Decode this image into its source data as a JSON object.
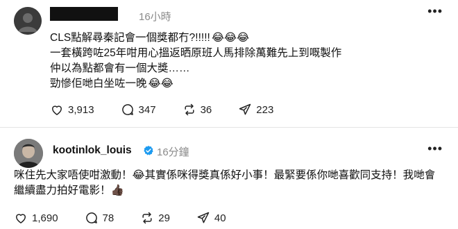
{
  "post1": {
    "time": "16小時",
    "lines": [
      "CLS點解尋秦記會一個獎都冇?!!!!!",
      "一套橫跨咗25年咁用心搵返晒原班人馬排除萬難先上到嘅製作",
      "仲以為點都會有一個大獎……",
      "勁慘佢哋白坐咗一晚"
    ],
    "emoji_line1": "😂😂😂",
    "emoji_line4": "😂😂",
    "likes": "3,913",
    "comments": "347",
    "reposts": "36",
    "shares": "223"
  },
  "post2": {
    "username": "kootinlok_louis",
    "time": "16分鐘",
    "lines": [
      "咪住先大家唔使咁激動！😂其實係咪得獎真係好小事！最緊要係你哋喜歡同支持！我哋會",
      "繼續盡力拍好電影！👍🏿"
    ],
    "likes": "1,690",
    "comments": "78",
    "reposts": "29",
    "shares": "40"
  },
  "icons": {
    "more": "more-icon",
    "like": "heart-icon",
    "comment": "comment-icon",
    "repost": "repost-icon",
    "share": "share-icon",
    "verified": "verified-badge-icon"
  },
  "colors": {
    "verified": "#1d9bf0",
    "muted": "#8a8a8a"
  }
}
